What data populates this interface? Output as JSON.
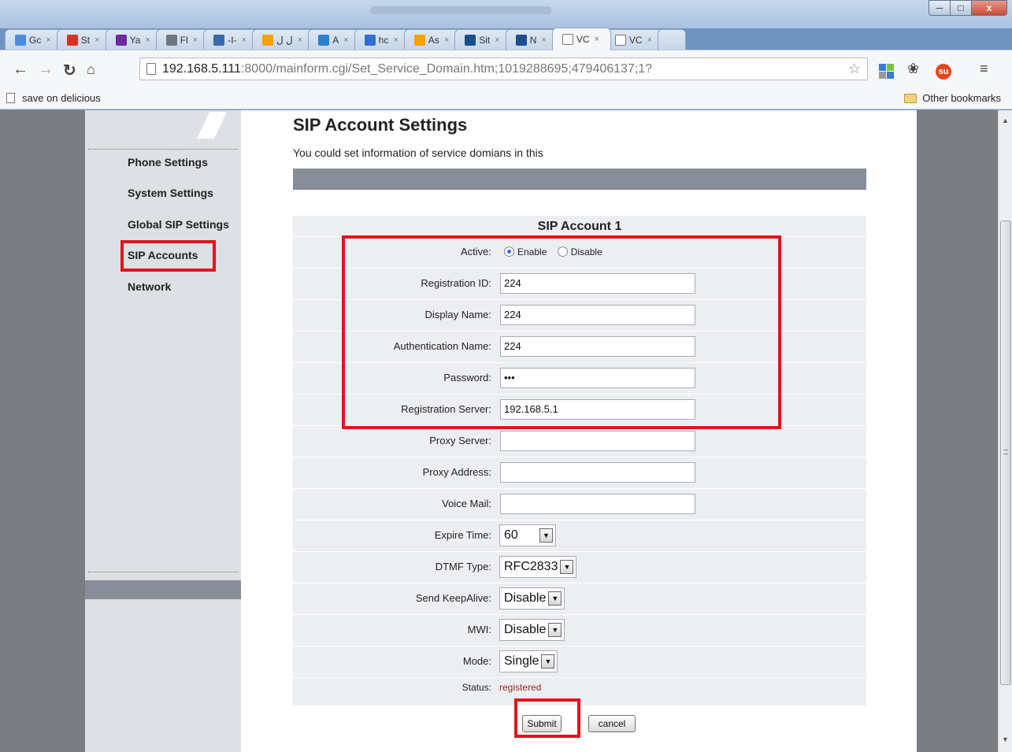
{
  "window": {
    "minimize_icon": "minimize-icon",
    "maximize_icon": "maximize-icon",
    "close_label": "x"
  },
  "tabs": [
    {
      "label": "Gc",
      "icon_color": "#4a8de0"
    },
    {
      "label": "St",
      "icon_color": "#d93025"
    },
    {
      "label": "Ya",
      "icon_color": "#6b2d9a"
    },
    {
      "label": "Fl",
      "icon_color": "#6f7680"
    },
    {
      "label": "-I-",
      "icon_color": "#3b6aa8"
    },
    {
      "label": "ل ل",
      "icon_color": "#f2a300"
    },
    {
      "label": "A",
      "icon_color": "#2f7fd0"
    },
    {
      "label": "hc",
      "icon_color": "#2f6fd0"
    },
    {
      "label": "As",
      "icon_color": "#f2a300"
    },
    {
      "label": "Sit",
      "icon_color": "#1b4f8a"
    },
    {
      "label": "N",
      "icon_color": "#1b4f8a"
    },
    {
      "label": "VC",
      "icon_color": "#ffffff"
    },
    {
      "label": "VC",
      "icon_color": "#ffffff"
    }
  ],
  "address_bar": {
    "host": "192.168.5.111",
    "rest": ":8000/mainform.cgi/Set_Service_Domain.htm;1019288695;479406137;1?"
  },
  "bookmarks": {
    "left_label": "save on delicious",
    "right_label": "Other bookmarks"
  },
  "sidebar": {
    "items": [
      "Phone Settings",
      "System Settings",
      "Global SIP Settings",
      "SIP Accounts",
      "Network"
    ]
  },
  "page": {
    "title": "SIP Account Settings",
    "description": "You could set information of service domians in this"
  },
  "account": {
    "heading": "SIP Account 1",
    "active_label": "Active:",
    "enable_label": "Enable",
    "disable_label": "Disable",
    "active_value": "Enable",
    "fields": {
      "registration_id": {
        "label": "Registration ID:",
        "value": "224"
      },
      "display_name": {
        "label": "Display Name:",
        "value": "224"
      },
      "auth_name": {
        "label": "Authentication Name:",
        "value": "224"
      },
      "password": {
        "label": "Password:",
        "value": "•••"
      },
      "reg_server": {
        "label": "Registration Server:",
        "value": "192.168.5.1"
      },
      "proxy_server": {
        "label": "Proxy Server:",
        "value": ""
      },
      "proxy_address": {
        "label": "Proxy Address:",
        "value": ""
      },
      "voice_mail": {
        "label": "Voice Mail:",
        "value": ""
      }
    },
    "selects": {
      "expire_time": {
        "label": "Expire Time:",
        "value": "60"
      },
      "dtmf_type": {
        "label": "DTMF Type:",
        "value": "RFC2833"
      },
      "send_keepalive": {
        "label": "Send KeepAlive:",
        "value": "Disable"
      },
      "mwi": {
        "label": "MWI:",
        "value": "Disable"
      },
      "mode": {
        "label": "Mode:",
        "value": "Single"
      }
    },
    "status_label": "Status:",
    "status_value": "registered"
  },
  "buttons": {
    "submit": "Submit",
    "cancel": "cancel"
  },
  "colors": {
    "highlight_red": "#e0151d",
    "banner_gray": "#878d99",
    "status_red": "#a3251c"
  }
}
